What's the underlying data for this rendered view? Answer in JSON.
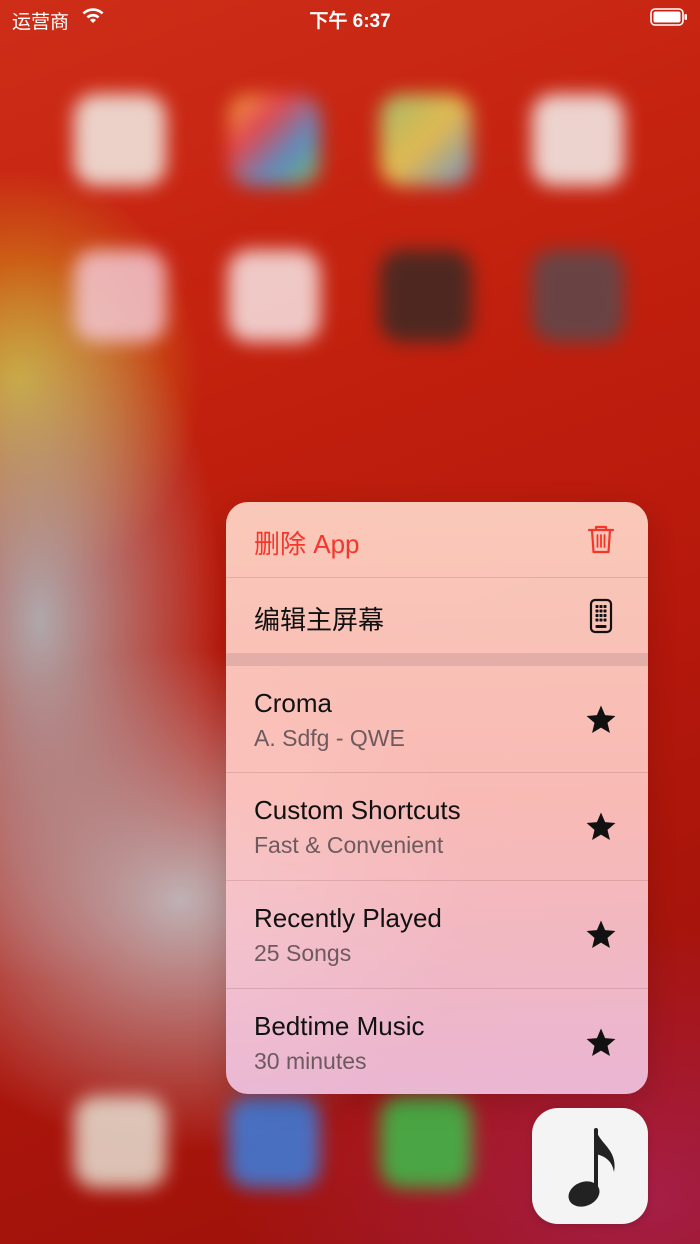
{
  "status_bar": {
    "carrier": "运营商",
    "time": "下午 6:37",
    "icons": [
      "wifi-icon",
      "battery-icon"
    ]
  },
  "menu": {
    "actions": [
      {
        "label": "删除 App",
        "icon": "trash-icon",
        "color": "#f5362b"
      },
      {
        "label": "编辑主屏幕",
        "icon": "phone-edit-icon"
      }
    ],
    "shortcuts": [
      {
        "title": "Croma",
        "subtitle": "A. Sdfg - QWE",
        "icon": "star-icon"
      },
      {
        "title": "Custom Shortcuts",
        "subtitle": "Fast & Convenient",
        "icon": "star-icon"
      },
      {
        "title": "Recently Played",
        "subtitle": "25 Songs",
        "icon": "star-icon"
      },
      {
        "title": "Bedtime Music",
        "subtitle": "30 minutes",
        "icon": "star-icon"
      }
    ]
  },
  "app_icon": {
    "glyph": "♪",
    "icon": "music-note-icon"
  },
  "colors": {
    "destructive": "#f5362b",
    "wallpaper": "#c41a0e"
  }
}
